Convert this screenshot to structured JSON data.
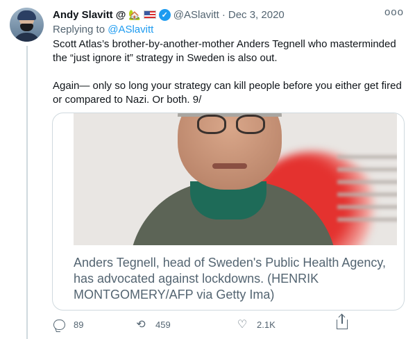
{
  "tweet": {
    "author_name": "Andy Slavitt",
    "author_suffix": "@",
    "name_emoji": "🏡",
    "handle": "@ASlavitt",
    "separator": "·",
    "date": "Dec 3, 2020",
    "more_label": "ooo",
    "replying_prefix": "Replying to",
    "replying_to": "@ASlavitt",
    "paragraph_1": "Scott Atlas’s brother-by-another-mother Anders Tegnell who masterminded the “just ignore it” strategy in Sweden is also out.",
    "paragraph_2": "Again— only so long your strategy can kill people before you either get fired or compared to Nazi. Or both. 9/",
    "card": {
      "caption": "Anders Tegnell, head of Sweden's Public Health Agency, has advocated against lockdowns. (HENRIK MONTGOMERY/AFP via Getty Ima)"
    },
    "actions": {
      "reply_count": "89",
      "retweet_count": "459",
      "like_count": "2.1K"
    }
  },
  "colors": {
    "accent": "#1d9bf0",
    "muted_text": "#536471",
    "border": "#cfd9de"
  },
  "icons": {
    "reply": "reply-icon",
    "retweet": "retweet-icon",
    "like": "heart-icon",
    "share": "share-icon",
    "verified": "verified-badge-icon",
    "flag": "us-flag-icon"
  }
}
